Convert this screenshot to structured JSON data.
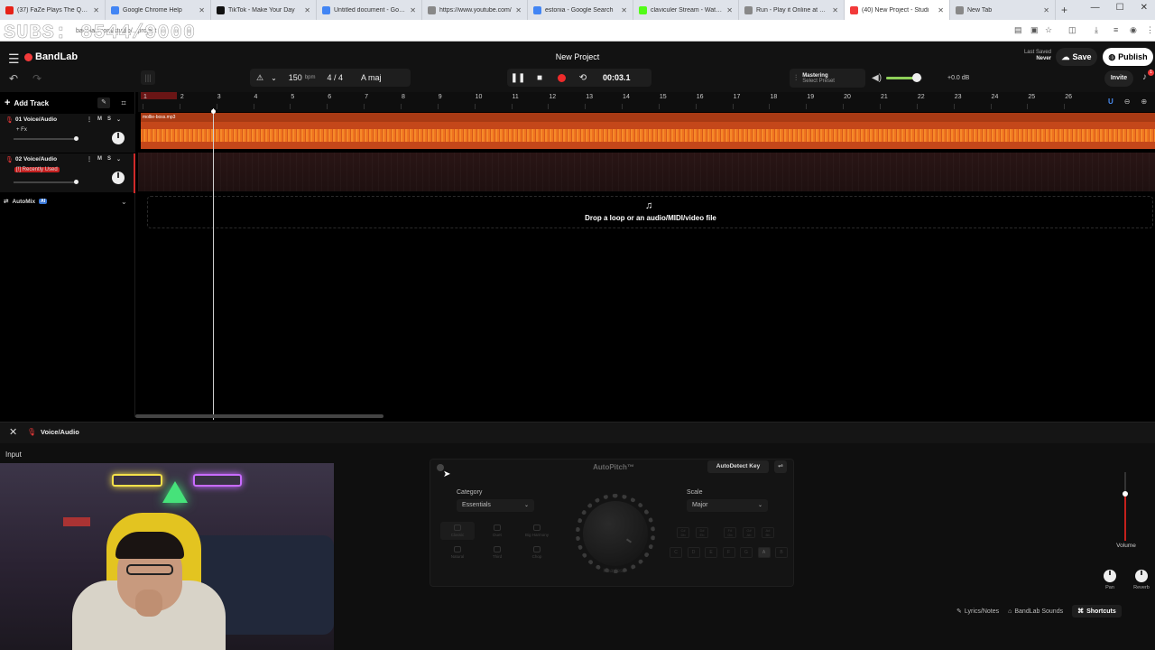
{
  "browser": {
    "tabs": [
      {
        "title": "(37) FaZe Plays The Quiet Pl",
        "color": "#e62117",
        "active": false
      },
      {
        "title": "Google Chrome Help",
        "color": "#4285f4",
        "active": false
      },
      {
        "title": "TikTok - Make Your Day",
        "color": "#111111",
        "active": false
      },
      {
        "title": "Untitled document - Google",
        "color": "#4285f4",
        "active": false
      },
      {
        "title": "https://www.youtube.com/",
        "color": "#888888",
        "active": false
      },
      {
        "title": "estonia - Google Search",
        "color": "#4285f4",
        "active": false
      },
      {
        "title": "claviculer Stream - Watch L",
        "color": "#53fc18",
        "active": false
      },
      {
        "title": "Run - Play it Online at Cool",
        "color": "#888888",
        "active": false
      },
      {
        "title": "(40) New Project - Studi",
        "color": "#f23a3a",
        "active": true
      },
      {
        "title": "New Tab",
        "color": "#888888",
        "active": false
      }
    ],
    "new_tab": "+",
    "url": "bandlab.com/studio/...project",
    "overlay_text": "SUBS: 8544/9000"
  },
  "header": {
    "app_name": "BandLab",
    "project_title": "New Project",
    "last_saved_label": "Last Saved",
    "last_saved_value": "Never",
    "save": "Save",
    "publish": "Publish",
    "invite": "Invite",
    "notif_count": "1"
  },
  "toolbar": {
    "bpm": "150",
    "bpm_unit": "bpm",
    "time_sig": "4 / 4",
    "key": "A maj",
    "time": "00:03.1",
    "mastering_title": "Mastering",
    "mastering_sub": "Select Preset",
    "master_db": "+0.0 dB",
    "master_volume_level": 0.85
  },
  "tracks_panel": {
    "add_track": "Add Track",
    "tracks": [
      {
        "name": "01  Voice/Audio",
        "m": "M",
        "s": "S",
        "fx": "+ Fx",
        "fx_color": "#121212"
      },
      {
        "name": "02  Voice/Audio",
        "m": "M",
        "s": "S",
        "fx": "[!] Recently Used",
        "fx_color": "#c42020"
      }
    ],
    "automix": "AutoMix",
    "automix_badge": "AI"
  },
  "timeline": {
    "bars": [
      "1",
      "2",
      "3",
      "4",
      "5",
      "6",
      "7",
      "8",
      "9",
      "10",
      "11",
      "12",
      "13",
      "14",
      "15",
      "16",
      "17",
      "18",
      "19",
      "20",
      "21",
      "22",
      "23",
      "24",
      "25",
      "26"
    ],
    "clip_name": "mollie-boss.mp3",
    "drop_text": "Drop a loop or an audio/MIDI/video file"
  },
  "editor": {
    "track_name": "Voice/Audio",
    "input_label": "Input",
    "autopitch_title": "AutoPitch™",
    "autodetect": "AutoDetect Key",
    "category_label": "Category",
    "category_value": "Essentials",
    "scale_label": "Scale",
    "scale_value": "Major",
    "presets": [
      "Classic",
      "Duet",
      "Big Harmony",
      "Natural",
      "Third",
      "Chop"
    ],
    "knob_label": "Heaviest",
    "keys_top": [
      "C#\nDb",
      "D#\nEb",
      "F#\nGb",
      "G#\nAb",
      "A#\nBb"
    ],
    "keys_bottom": [
      "C",
      "D",
      "E",
      "F",
      "G",
      "A",
      "B"
    ],
    "volume_label": "Volume",
    "volume_level": 0.68,
    "pan_label": "Pan",
    "reverb_label": "Reverb"
  },
  "footer": {
    "lyrics": "Lyrics/Notes",
    "sounds": "BandLab Sounds",
    "shortcuts": "Shortcuts"
  }
}
